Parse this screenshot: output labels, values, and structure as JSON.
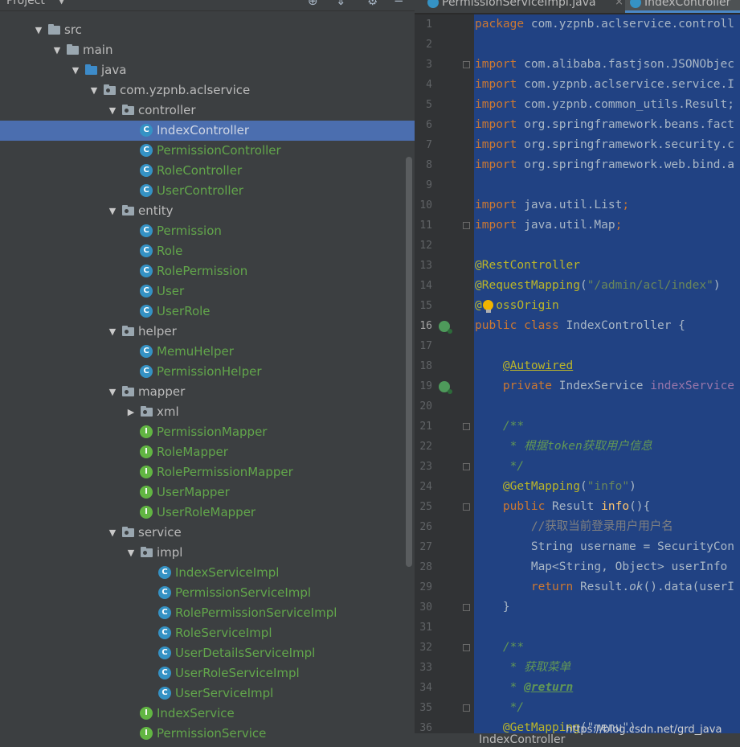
{
  "project": {
    "title": "Project",
    "tree": [
      {
        "label": "src",
        "kind": "folder",
        "depth": 0,
        "arrow": "down"
      },
      {
        "label": "main",
        "kind": "folder",
        "depth": 1,
        "arrow": "down"
      },
      {
        "label": "java",
        "kind": "folder-blue",
        "depth": 2,
        "arrow": "down"
      },
      {
        "label": "com.yzpnb.aclservice",
        "kind": "package",
        "depth": 3,
        "arrow": "down"
      },
      {
        "label": "controller",
        "kind": "package",
        "depth": 4,
        "arrow": "down"
      },
      {
        "label": "IndexController",
        "kind": "class",
        "depth": 5,
        "selected": true
      },
      {
        "label": "PermissionController",
        "kind": "class",
        "depth": 5
      },
      {
        "label": "RoleController",
        "kind": "class",
        "depth": 5
      },
      {
        "label": "UserController",
        "kind": "class",
        "depth": 5
      },
      {
        "label": "entity",
        "kind": "package",
        "depth": 4,
        "arrow": "down"
      },
      {
        "label": "Permission",
        "kind": "class",
        "depth": 5
      },
      {
        "label": "Role",
        "kind": "class",
        "depth": 5
      },
      {
        "label": "RolePermission",
        "kind": "class",
        "depth": 5
      },
      {
        "label": "User",
        "kind": "class",
        "depth": 5
      },
      {
        "label": "UserRole",
        "kind": "class",
        "depth": 5
      },
      {
        "label": "helper",
        "kind": "package",
        "depth": 4,
        "arrow": "down"
      },
      {
        "label": "MemuHelper",
        "kind": "class",
        "depth": 5
      },
      {
        "label": "PermissionHelper",
        "kind": "class",
        "depth": 5
      },
      {
        "label": "mapper",
        "kind": "package",
        "depth": 4,
        "arrow": "down"
      },
      {
        "label": "xml",
        "kind": "package",
        "depth": 5,
        "arrow": "right"
      },
      {
        "label": "PermissionMapper",
        "kind": "interface",
        "depth": 5
      },
      {
        "label": "RoleMapper",
        "kind": "interface",
        "depth": 5
      },
      {
        "label": "RolePermissionMapper",
        "kind": "interface",
        "depth": 5
      },
      {
        "label": "UserMapper",
        "kind": "interface",
        "depth": 5
      },
      {
        "label": "UserRoleMapper",
        "kind": "interface",
        "depth": 5
      },
      {
        "label": "service",
        "kind": "package",
        "depth": 4,
        "arrow": "down"
      },
      {
        "label": "impl",
        "kind": "package",
        "depth": 5,
        "arrow": "down"
      },
      {
        "label": "IndexServiceImpl",
        "kind": "class",
        "depth": 6
      },
      {
        "label": "PermissionServiceImpl",
        "kind": "class",
        "depth": 6
      },
      {
        "label": "RolePermissionServiceImpl",
        "kind": "class",
        "depth": 6
      },
      {
        "label": "RoleServiceImpl",
        "kind": "class",
        "depth": 6
      },
      {
        "label": "UserDetailsServiceImpl",
        "kind": "class",
        "depth": 6
      },
      {
        "label": "UserRoleServiceImpl",
        "kind": "class",
        "depth": 6
      },
      {
        "label": "UserServiceImpl",
        "kind": "class",
        "depth": 6
      },
      {
        "label": "IndexService",
        "kind": "interface",
        "depth": 5
      },
      {
        "label": "PermissionService",
        "kind": "interface",
        "depth": 5
      }
    ]
  },
  "editor": {
    "tabs": [
      {
        "label": "PermissionServiceImpl.java",
        "close": "×"
      },
      {
        "label": "IndexController",
        "close": ""
      }
    ],
    "current_line": 16,
    "lines": [
      [
        [
          "kw",
          "package "
        ],
        [
          "",
          "com.yzpnb.aclservice.controll"
        ]
      ],
      [],
      [
        [
          "kw",
          "import "
        ],
        [
          "",
          "com.alibaba.fastjson.JSONObjec"
        ]
      ],
      [
        [
          "kw",
          "import "
        ],
        [
          "",
          "com.yzpnb.aclservice.service.I"
        ]
      ],
      [
        [
          "kw",
          "import "
        ],
        [
          "",
          "com.yzpnb.common_utils.Result;"
        ]
      ],
      [
        [
          "kw",
          "import "
        ],
        [
          "",
          "org.springframework.beans.fact"
        ]
      ],
      [
        [
          "kw",
          "import "
        ],
        [
          "",
          "org.springframework.security.c"
        ]
      ],
      [
        [
          "kw",
          "import "
        ],
        [
          "",
          "org.springframework.web.bind.a"
        ]
      ],
      [],
      [
        [
          "kw",
          "import "
        ],
        [
          "",
          "java.util.List"
        ],
        [
          "kw",
          ";"
        ]
      ],
      [
        [
          "kw",
          "import "
        ],
        [
          "",
          "java.util.Map"
        ],
        [
          "kw",
          ";"
        ]
      ],
      [],
      [
        [
          "an",
          "@RestController"
        ]
      ],
      [
        [
          "an",
          "@RequestMapping"
        ],
        [
          "",
          "("
        ],
        [
          "st",
          "\"/admin/acl/index\""
        ],
        [
          "",
          ")"
        ]
      ],
      [
        [
          "an",
          "@"
        ],
        [
          "",
          "  "
        ],
        [
          "an",
          "ossOrigin"
        ]
      ],
      [
        [
          "kw",
          "public class "
        ],
        [
          "",
          "IndexController {"
        ]
      ],
      [],
      [
        [
          "",
          "    "
        ],
        [
          "an underline",
          "@Autowired"
        ]
      ],
      [
        [
          "",
          "    "
        ],
        [
          "kw",
          "private "
        ],
        [
          "",
          "IndexService "
        ],
        [
          "fld",
          "indexService"
        ]
      ],
      [],
      [
        [
          "",
          "    "
        ],
        [
          "cm",
          "/**"
        ]
      ],
      [
        [
          "",
          "     "
        ],
        [
          "cm",
          "* 根据token获取用户信息"
        ]
      ],
      [
        [
          "",
          "     "
        ],
        [
          "cm",
          "*/"
        ]
      ],
      [
        [
          "",
          "    "
        ],
        [
          "an",
          "@GetMapping"
        ],
        [
          "",
          "("
        ],
        [
          "st",
          "\"info\""
        ],
        [
          "",
          ")"
        ]
      ],
      [
        [
          "",
          "    "
        ],
        [
          "kw",
          "public "
        ],
        [
          "",
          "Result "
        ],
        [
          "mt",
          "info"
        ],
        [
          "",
          "(){"
        ]
      ],
      [
        [
          "",
          "        "
        ],
        [
          "lc",
          "//获取当前登录用户用户名"
        ]
      ],
      [
        [
          "",
          "        "
        ],
        [
          "",
          "String username = SecurityCon"
        ]
      ],
      [
        [
          "",
          "        "
        ],
        [
          "",
          "Map<String, Object> userInfo "
        ]
      ],
      [
        [
          "",
          "        "
        ],
        [
          "kw",
          "return "
        ],
        [
          "",
          "Result."
        ],
        [
          "itl",
          "ok"
        ],
        [
          "",
          "().data(userI"
        ]
      ],
      [
        [
          "",
          "    "
        ],
        [
          "",
          "}"
        ]
      ],
      [],
      [
        [
          "",
          "    "
        ],
        [
          "cm",
          "/**"
        ]
      ],
      [
        [
          "",
          "     "
        ],
        [
          "cm",
          "* 获取菜单"
        ]
      ],
      [
        [
          "",
          "     "
        ],
        [
          "cm",
          "* "
        ],
        [
          "tagcm",
          "@return"
        ]
      ],
      [
        [
          "",
          "     "
        ],
        [
          "cm",
          "*/"
        ]
      ],
      [
        [
          "",
          "    "
        ],
        [
          "an",
          "@GetMapping"
        ],
        [
          "",
          "(\"menu\")"
        ]
      ]
    ]
  },
  "breadcrumb": "IndexController",
  "watermark": "https://blog.csdn.net/grd_java"
}
